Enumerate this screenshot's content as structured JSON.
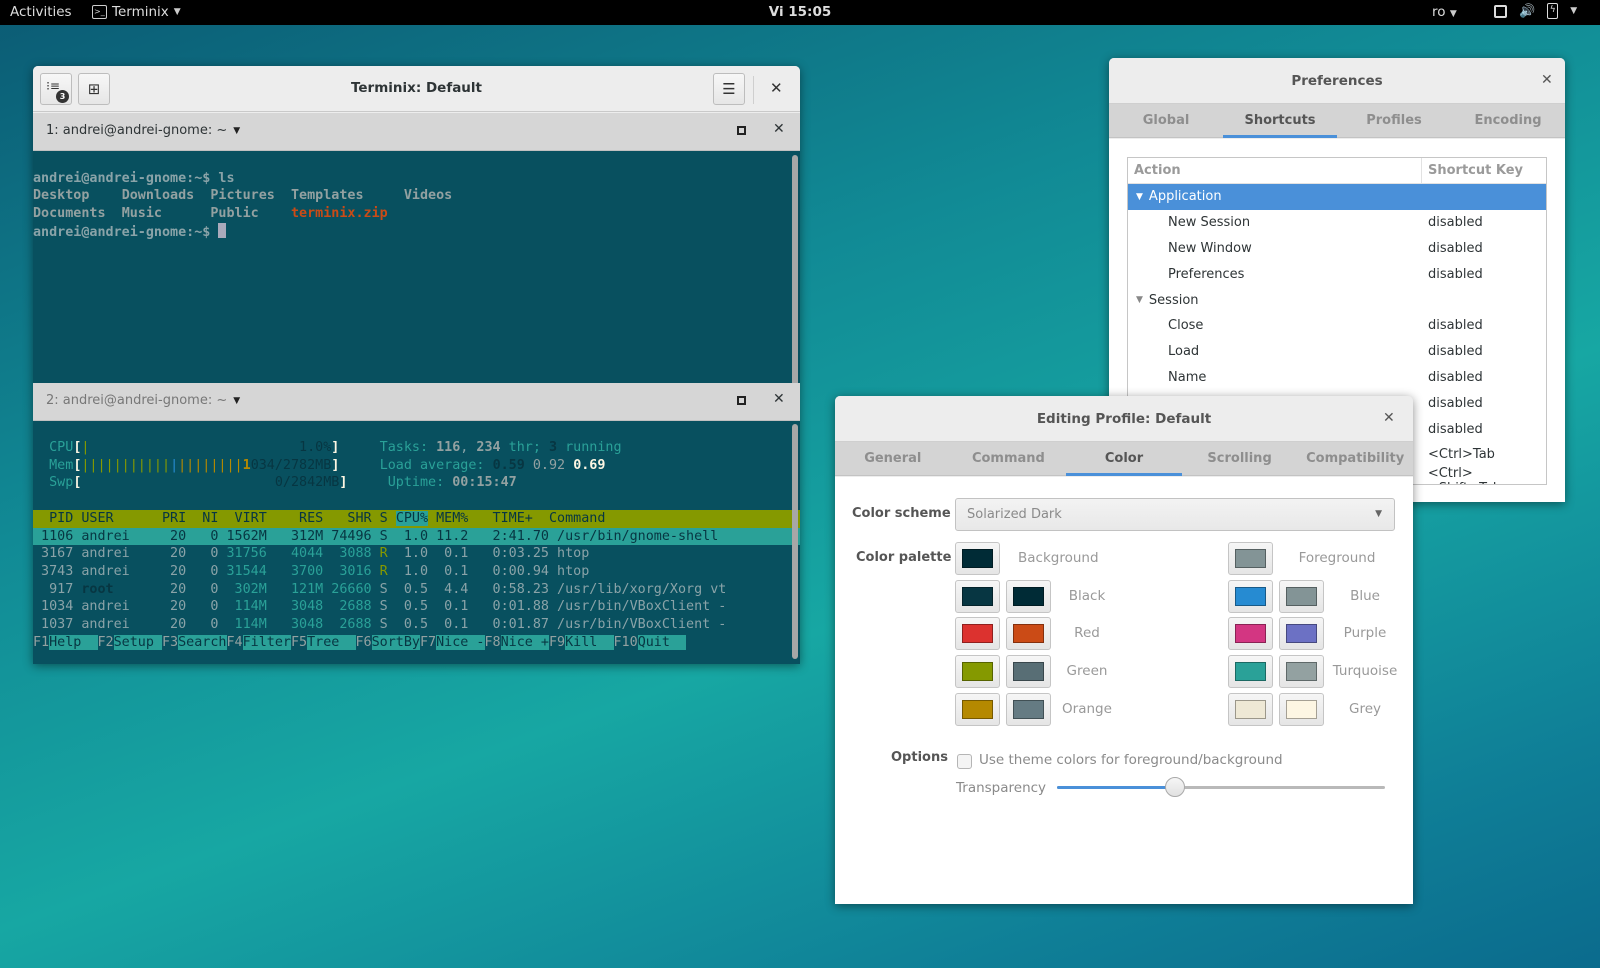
{
  "topbar": {
    "activities": "Activities",
    "app_name": "Terminix",
    "clock": "Vi 15:05",
    "language": "ro"
  },
  "terminix": {
    "title": "Terminix: Default",
    "session_count": "3",
    "panes": [
      {
        "title": "1: andrei@andrei-gnome: ~"
      },
      {
        "title": "2: andrei@andrei-gnome: ~"
      }
    ],
    "pane1": {
      "prompt1": "andrei@andrei-gnome:~$ ls",
      "ls_row1": [
        "Desktop",
        "Downloads",
        "Pictures",
        "Templates",
        "Videos"
      ],
      "ls_row2": [
        "Documents",
        "Music",
        "Public",
        "terminix.zip"
      ],
      "prompt2": "andrei@andrei-gnome:~$ "
    },
    "htop": {
      "cpu_label": "CPU",
      "cpu_value": "1.0%",
      "mem_label": "Mem",
      "mem_value": "034/2782MB",
      "mem_value_lead": "1",
      "swp_label": "Swp",
      "swp_value": "0/2842MB",
      "tasks_label": "Tasks:",
      "tasks": "116",
      "threads": "234",
      "thr_label": "thr;",
      "running": "3",
      "running_label": "running",
      "load_label": "Load average:",
      "load1": "0.59",
      "load5": "0.92",
      "load15": "0.69",
      "uptime_label": "Uptime:",
      "uptime": "00:15:47",
      "columns": [
        "PID",
        "USER",
        "PRI",
        "NI",
        "VIRT",
        "RES",
        "SHR",
        "S",
        "CPU%",
        "MEM%",
        "TIME+",
        "Command"
      ],
      "processes": [
        {
          "pid": "1106",
          "user": "andrei",
          "pri": "20",
          "ni": "0",
          "virt": "1562M",
          "res": "312M",
          "shr": "74496",
          "s": "S",
          "cpu": "1.0",
          "mem": "11.2",
          "time": "2:41.70",
          "cmd": "/usr/bin/gnome-shell"
        },
        {
          "pid": "3167",
          "user": "andrei",
          "pri": "20",
          "ni": "0",
          "virt": "31756",
          "res": "4044",
          "shr": "3088",
          "s": "R",
          "cpu": "1.0",
          "mem": "0.1",
          "time": "0:03.25",
          "cmd": "htop"
        },
        {
          "pid": "3743",
          "user": "andrei",
          "pri": "20",
          "ni": "0",
          "virt": "31544",
          "res": "3700",
          "shr": "3016",
          "s": "R",
          "cpu": "1.0",
          "mem": "0.1",
          "time": "0:00.94",
          "cmd": "htop"
        },
        {
          "pid": "917",
          "user": "root",
          "pri": "20",
          "ni": "0",
          "virt": "302M",
          "res": "121M",
          "shr": "26660",
          "s": "S",
          "cpu": "0.5",
          "mem": "4.4",
          "time": "0:58.23",
          "cmd": "/usr/lib/xorg/Xorg vt"
        },
        {
          "pid": "1034",
          "user": "andrei",
          "pri": "20",
          "ni": "0",
          "virt": "114M",
          "res": "3048",
          "shr": "2688",
          "s": "S",
          "cpu": "0.5",
          "mem": "0.1",
          "time": "0:01.88",
          "cmd": "/usr/bin/VBoxClient -"
        },
        {
          "pid": "1037",
          "user": "andrei",
          "pri": "20",
          "ni": "0",
          "virt": "114M",
          "res": "3048",
          "shr": "2688",
          "s": "S",
          "cpu": "0.5",
          "mem": "0.1",
          "time": "0:01.87",
          "cmd": "/usr/bin/VBoxClient -"
        }
      ],
      "fkeys": [
        {
          "key": "F1",
          "label": "Help  "
        },
        {
          "key": "F2",
          "label": "Setup "
        },
        {
          "key": "F3",
          "label": "Search"
        },
        {
          "key": "F4",
          "label": "Filter"
        },
        {
          "key": "F5",
          "label": "Tree  "
        },
        {
          "key": "F6",
          "label": "SortBy"
        },
        {
          "key": "F7",
          "label": "Nice -"
        },
        {
          "key": "F8",
          "label": "Nice +"
        },
        {
          "key": "F9",
          "label": "Kill  "
        },
        {
          "key": "F10",
          "label": "Quit  "
        }
      ]
    }
  },
  "preferences": {
    "title": "Preferences",
    "tabs": [
      "Global",
      "Shortcuts",
      "Profiles",
      "Encoding"
    ],
    "active_tab": "Shortcuts",
    "columns": [
      "Action",
      "Shortcut Key"
    ],
    "rows": [
      {
        "action": "Application",
        "key": "",
        "group": true,
        "selected": true
      },
      {
        "action": "New Session",
        "key": "disabled"
      },
      {
        "action": "New Window",
        "key": "disabled"
      },
      {
        "action": "Preferences",
        "key": "disabled"
      },
      {
        "action": "Session",
        "key": "",
        "group": true
      },
      {
        "action": "Close",
        "key": "disabled"
      },
      {
        "action": "Load",
        "key": "disabled"
      },
      {
        "action": "Name",
        "key": "disabled"
      },
      {
        "action": "",
        "key": "disabled"
      },
      {
        "action": "",
        "key": "disabled"
      },
      {
        "action": "",
        "key": "<Ctrl>Tab"
      },
      {
        "action": "",
        "key": "<Ctrl><Shift>Tab"
      }
    ]
  },
  "edit_profile": {
    "title": "Editing Profile: Default",
    "tabs": [
      "General",
      "Command",
      "Color",
      "Scrolling",
      "Compatibility"
    ],
    "active_tab": "Color",
    "color_scheme_label": "Color scheme",
    "color_scheme_value": "Solarized Dark",
    "palette_label": "Color palette",
    "palette": {
      "background": {
        "label": "Background",
        "color": "#002b36"
      },
      "foreground": {
        "label": "Foreground",
        "color": "#839496"
      },
      "left": [
        {
          "label": "Black",
          "normal": "#073642",
          "bright": "#002b36"
        },
        {
          "label": "Red",
          "normal": "#dc322f",
          "bright": "#cb4b16"
        },
        {
          "label": "Green",
          "normal": "#859900",
          "bright": "#586e75"
        },
        {
          "label": "Orange",
          "normal": "#b58900",
          "bright": "#657b83"
        }
      ],
      "right": [
        {
          "label": "Blue",
          "normal": "#268bd2",
          "bright": "#839496"
        },
        {
          "label": "Purple",
          "normal": "#d33682",
          "bright": "#6c71c4"
        },
        {
          "label": "Turquoise",
          "normal": "#2aa198",
          "bright": "#93a1a1"
        },
        {
          "label": "Grey",
          "normal": "#eee8d5",
          "bright": "#fdf6e3"
        }
      ]
    },
    "options_label": "Options",
    "use_theme_colors_label": "Use theme colors for foreground/background",
    "use_theme_colors_checked": false,
    "transparency_label": "Transparency",
    "transparency_value": 0.36
  }
}
